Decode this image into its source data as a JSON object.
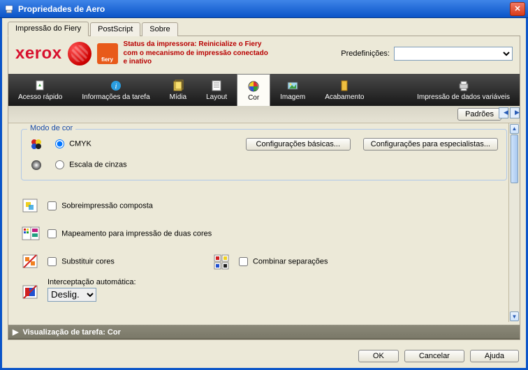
{
  "window": {
    "title": "Propriedades de Aero"
  },
  "tabs": {
    "fiery": "Impressão do Fiery",
    "postscript": "PostScript",
    "about": "Sobre"
  },
  "brand": {
    "xerox": "xerox",
    "fiery": "fiery",
    "status": "Status da impressora: Reinicialize o Fiery com o mecanismo de impressão conectado e inativo",
    "presets_label": "Predefinições:"
  },
  "toolbar": {
    "quick": "Acesso rápido",
    "jobinfo": "Informações da tarefa",
    "media": "Mídia",
    "layout": "Layout",
    "color": "Cor",
    "image": "Imagem",
    "finishing": "Acabamento",
    "vdp": "Impressão de dados variáveis",
    "defaults": "Padrões"
  },
  "color": {
    "group": "Modo de cor",
    "cmyk": "CMYK",
    "grayscale": "Escala de cinzas",
    "basic_btn": "Configurações básicas...",
    "expert_btn": "Configurações para especialistas...",
    "composite": "Sobreimpressão composta",
    "twocolor": "Mapeamento para impressão de duas cores",
    "substitute": "Substituir cores",
    "combine_sep": "Combinar separações",
    "autotrap_label": "Interceptação automática:",
    "autotrap_value": "Deslig."
  },
  "preview": {
    "label": "Visualização de tarefa: Cor"
  },
  "footer": {
    "ok": "OK",
    "cancel": "Cancelar",
    "help": "Ajuda"
  }
}
